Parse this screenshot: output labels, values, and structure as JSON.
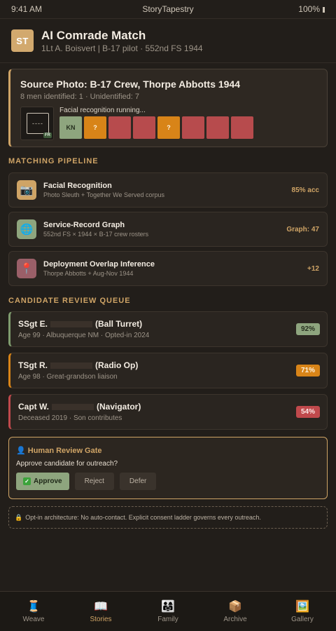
{
  "status": {
    "time": "9:41 AM",
    "app_name": "StoryTapestry",
    "battery": "100%"
  },
  "header": {
    "avatar_initials": "ST",
    "title": "AI Comrade Match",
    "subtitle": "1Lt A. Boisvert | B-17 pilot · 552nd FS 1944"
  },
  "source": {
    "title": "Source Photo: B-17 Crew, Thorpe Abbotts 1944",
    "summary": "8 men identified: 1 · Unidentified: 7",
    "thumb_glyph": "----",
    "thumb_badge": "FR",
    "recognition_status": "Facial recognition running...",
    "faces": [
      {
        "label": "KN",
        "state": "match"
      },
      {
        "label": "?",
        "state": "unknown"
      },
      {
        "label": "",
        "state": "unid"
      },
      {
        "label": "",
        "state": "unid"
      },
      {
        "label": "?",
        "state": "unknown"
      },
      {
        "label": "",
        "state": "unid"
      },
      {
        "label": "",
        "state": "unid"
      },
      {
        "label": "",
        "state": "unid"
      }
    ]
  },
  "pipeline": {
    "section_title": "MATCHING PIPELINE",
    "items": [
      {
        "icon": "camera-icon",
        "glyph": "📷",
        "bg": "#cfa466",
        "name": "Facial Recognition",
        "detail": "Photo Sleuth + Together We Served corpus",
        "metric": "85% acc"
      },
      {
        "icon": "globe-icon",
        "glyph": "🌐",
        "bg": "#8ea57e",
        "name": "Service-Record Graph",
        "detail": "552nd FS × 1944 × B-17 crew rosters",
        "metric": "Graph: 47"
      },
      {
        "icon": "map-pin-icon",
        "glyph": "📍",
        "bg": "#9a5f68",
        "name": "Deployment Overlap Inference",
        "detail": "Thorpe Abbotts + Aug-Nov 1944",
        "metric": "+12"
      }
    ]
  },
  "queue": {
    "section_title": "CANDIDATE REVIEW QUEUE",
    "candidates": [
      {
        "rank": "SSgt E.",
        "role": "(Ball Turret)",
        "detail": "Age 99 · Albuquerque NM · Opted-in 2024",
        "score": "92%",
        "tone": "green"
      },
      {
        "rank": "TSgt R.",
        "role": "(Radio Op)",
        "detail": "Age 98 · Great-grandson liaison",
        "score": "71%",
        "tone": "orange"
      },
      {
        "rank": "Capt W.",
        "role": "(Navigator)",
        "detail": "Deceased 2019 · Son contributes",
        "score": "54%",
        "tone": "red"
      }
    ]
  },
  "gate": {
    "icon": "person-icon",
    "title": "👤 Human Review Gate",
    "question": "Approve candidate for outreach?",
    "approve_label": "Approve",
    "reject_label": "Reject",
    "defer_label": "Defer"
  },
  "note": {
    "icon": "lock-icon",
    "text": "Opt-in architecture: No auto-contact. Explicit consent ladder governs every outreach."
  },
  "nav": [
    {
      "icon": "spool-icon",
      "glyph": "🧵",
      "label": "Weave",
      "active": false
    },
    {
      "icon": "book-icon",
      "glyph": "📖",
      "label": "Stories",
      "active": true
    },
    {
      "icon": "family-icon",
      "glyph": "👨‍👩‍👧",
      "label": "Family",
      "active": false
    },
    {
      "icon": "box-icon",
      "glyph": "📦",
      "label": "Archive",
      "active": false
    },
    {
      "icon": "picture-icon",
      "glyph": "🖼️",
      "label": "Gallery",
      "active": false
    }
  ]
}
